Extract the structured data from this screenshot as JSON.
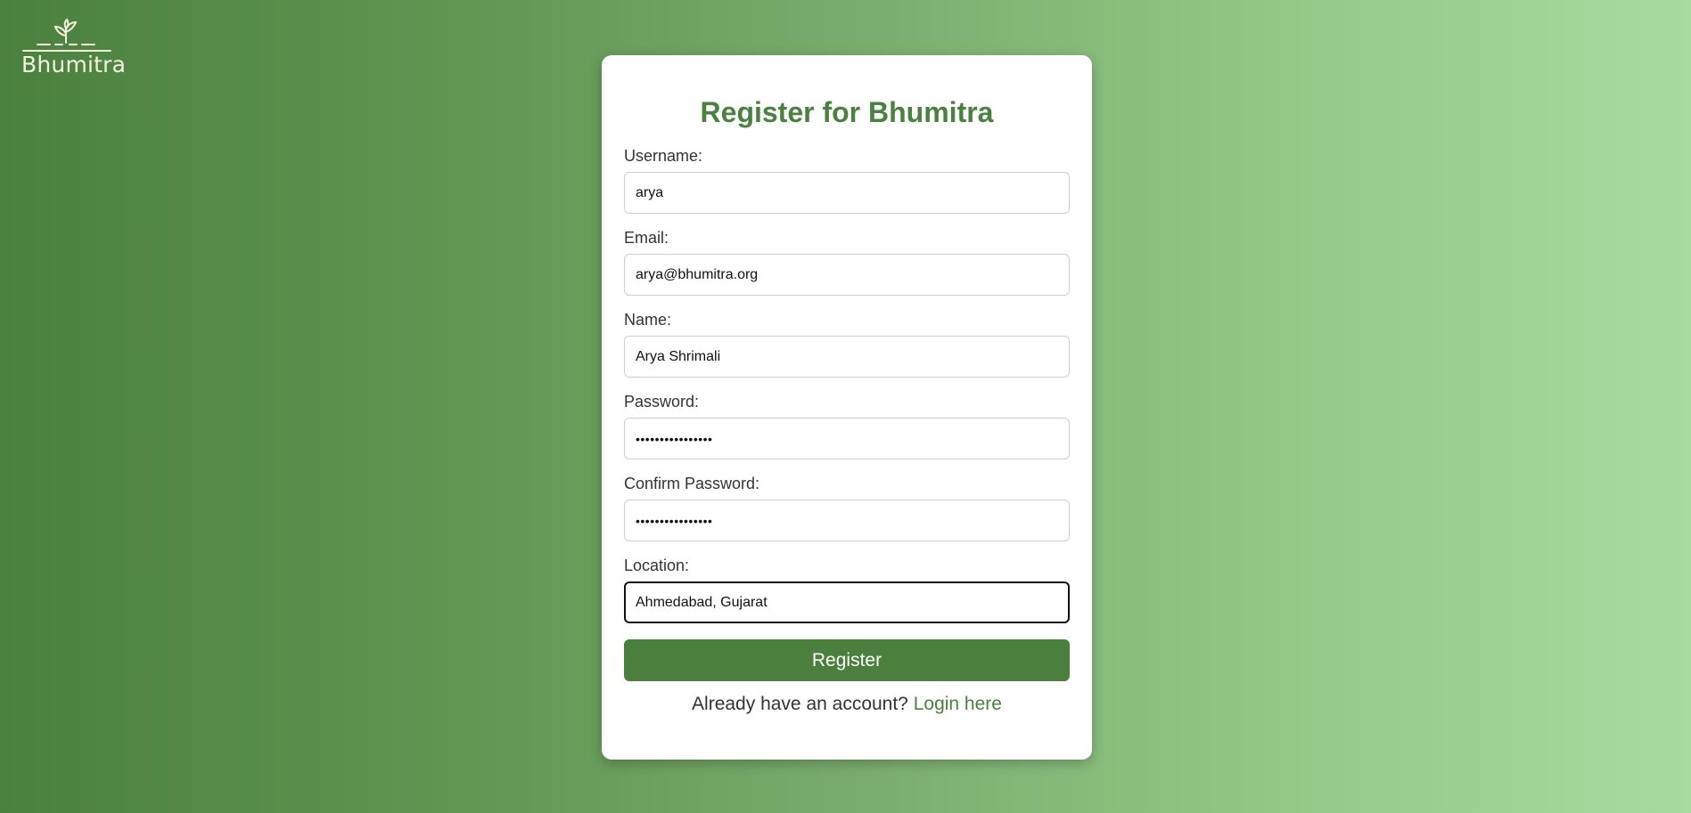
{
  "logo": {
    "text": "Bhumitra",
    "icon": "sprout-icon"
  },
  "form": {
    "title": "Register for Bhumitra",
    "fields": [
      {
        "label": "Username:",
        "value": "arya",
        "type": "text"
      },
      {
        "label": "Email:",
        "value": "arya@bhumitra.org",
        "type": "email"
      },
      {
        "label": "Name:",
        "value": "Arya Shrimali",
        "type": "text"
      },
      {
        "label": "Password:",
        "value": "••••••••••••••••",
        "type": "password"
      },
      {
        "label": "Confirm Password:",
        "value": "••••••••••••••••",
        "type": "password"
      },
      {
        "label": "Location:",
        "value": "Ahmedabad, Gujarat",
        "type": "text",
        "focused": true
      }
    ],
    "submit_label": "Register",
    "footer_prompt": "Already have an account?",
    "login_link": "Login here"
  },
  "colors": {
    "brand_green": "#4b813f",
    "button_green": "#4a7f3e",
    "background_start": "#4b813f",
    "background_end": "#a8dba0"
  }
}
